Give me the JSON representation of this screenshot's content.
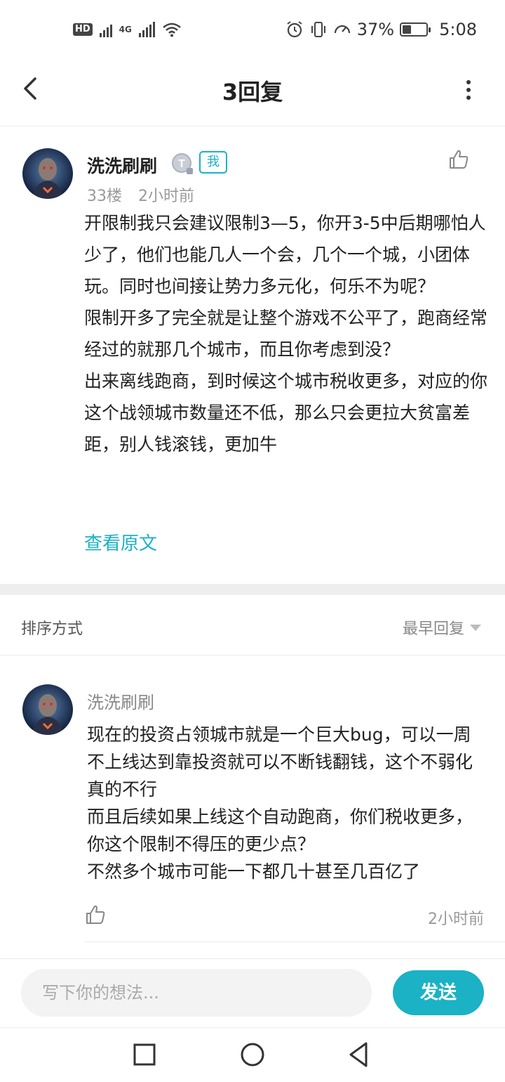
{
  "status_bar": {
    "left_badge": "HD",
    "network": "4G",
    "battery_percent": "37%",
    "battery_level": 0.37,
    "time": "5:08"
  },
  "header": {
    "title": "3回复",
    "back_icon": "chevron-left-icon",
    "more_icon": "more-vertical-icon"
  },
  "post": {
    "author": "洗洗刷刷",
    "me_badge": "我",
    "floor": "33楼",
    "time": "2小时前",
    "paragraphs": [
      "开限制我只会建议限制3—5，你开3-5中后期哪怕人少了，他们也能几人一个会，几个一个城，小团体玩。同时也间接让势力多元化，何乐不为呢？",
      "限制开多了完全就是让整个游戏不公平了，跑商经常经过的就那几个城市，而且你考虑到没？",
      "出来离线跑商，到时候这个城市税收更多，对应的你这个战领城市数量还不低，那么只会更拉大贫富差距，别人钱滚钱，更加牛"
    ],
    "view_original": "查看原文"
  },
  "sort_bar": {
    "label": "排序方式",
    "selected": "最早回复"
  },
  "reply": {
    "author": "洗洗刷刷",
    "lines": [
      "现在的投资占领城市就是一个巨大bug，可以一周不上线达到靠投资就可以不断钱翻钱，这个不弱化真的不行",
      "而且后续如果上线这个自动跑商，你们税收更多，你这个限制不得压的更少点？",
      "不然多个城市可能一下都几十甚至几百亿了"
    ],
    "time": "2小时前"
  },
  "comment_bar": {
    "placeholder": "写下你的想法...",
    "send_label": "发送"
  },
  "colors": {
    "accent": "#1ab2c4",
    "text": "#222222",
    "muted": "#999999"
  }
}
